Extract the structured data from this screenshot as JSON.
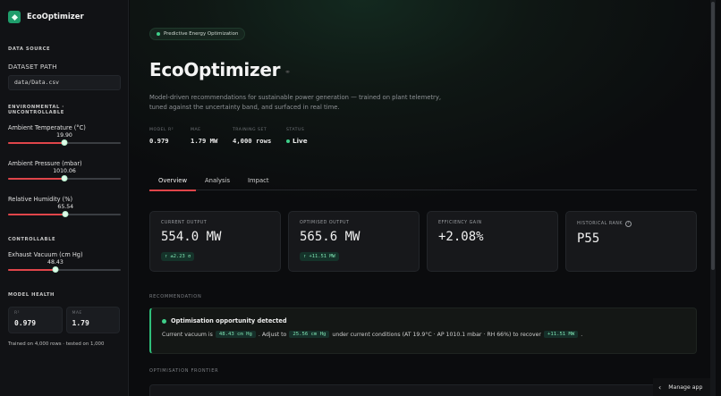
{
  "app": {
    "name": "EcoOptimizer"
  },
  "sidebar": {
    "data_source_heading": "DATA SOURCE",
    "dataset_label": "DATASET PATH",
    "dataset_value": "data/Data.csv",
    "env_heading": "ENVIRONMENTAL · UNCONTROLLABLE",
    "controllable_heading": "CONTROLLABLE",
    "sliders": [
      {
        "label": "Ambient Temperature (°C)",
        "value": "19.90",
        "fraction": 0.5
      },
      {
        "label": "Ambient Pressure (mbar)",
        "value": "1010.06",
        "fraction": 0.5
      },
      {
        "label": "Relative Humidity (%)",
        "value": "65.54",
        "fraction": 0.51
      },
      {
        "label": "Exhaust Vacuum (cm Hg)",
        "value": "48.43",
        "fraction": 0.42
      }
    ],
    "health_heading": "MODEL HEALTH",
    "health": [
      {
        "key": "R²",
        "value": "0.979"
      },
      {
        "key": "MAE",
        "value": "1.79"
      }
    ],
    "train_note": "Trained on 4,000 rows · tested on 1,000"
  },
  "main": {
    "pill": "Predictive Energy Optimization",
    "title": "EcoOptimizer",
    "description": "Model-driven recommendations for sustainable power generation — trained on plant telemetry, tuned against the uncertainty band, and surfaced in real time.",
    "stats": [
      {
        "key": "MODEL R²",
        "value": "0.979"
      },
      {
        "key": "MAE",
        "value": "1.79 MW"
      },
      {
        "key": "TRAINING SET",
        "value": "4,000 rows"
      },
      {
        "key": "STATUS",
        "value": "Live"
      }
    ],
    "tabs": [
      "Overview",
      "Analysis",
      "Impact"
    ],
    "cards": [
      {
        "key": "CURRENT OUTPUT",
        "value": "554.0 MW",
        "chip": "↑ ±2.23 σ"
      },
      {
        "key": "OPTIMISED OUTPUT",
        "value": "565.6 MW",
        "chip": "↑ +11.51 MW"
      },
      {
        "key": "EFFICIENCY GAIN",
        "value": "+2.08%",
        "chip": ""
      },
      {
        "key": "HISTORICAL RANK",
        "value": "P55",
        "chip": ""
      }
    ],
    "recommendation_heading": "RECOMMENDATION",
    "reco": {
      "title": "Optimisation opportunity detected",
      "t1": "Current vacuum is",
      "c1": "48.43 cm Hg",
      "t2": ". Adjust to",
      "c2": "25.56 cm Hg",
      "t3": "under current conditions (AT 19.9°C · AP 1010.1 mbar · RH 66%) to recover",
      "c3": "+11.51 MW",
      "t4": "."
    },
    "frontier_heading": "OPTIMISATION FRONTIER",
    "manage_app": "Manage app"
  },
  "colors": {
    "accent": "#3fd08a",
    "slider_fill": "#e0454a",
    "tab_indicator": "#e0454a"
  }
}
